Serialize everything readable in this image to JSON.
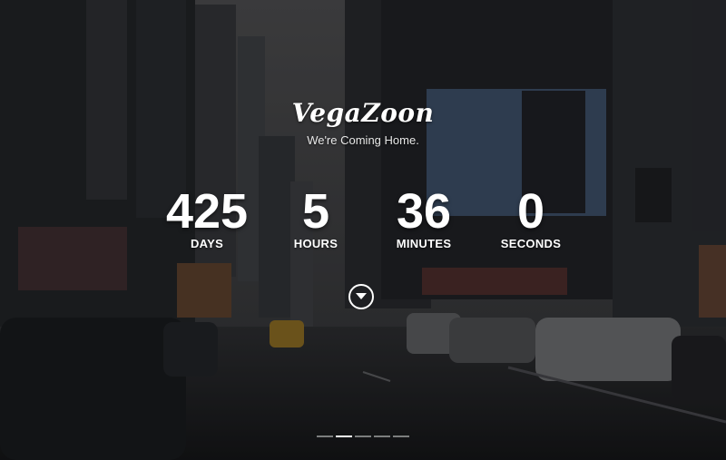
{
  "brand": {
    "logo": "VegaZoon",
    "tagline": "We're Coming Home."
  },
  "countdown": [
    {
      "value": "425",
      "label": "DAYS"
    },
    {
      "value": "5",
      "label": "HOURS"
    },
    {
      "value": "36",
      "label": "MINUTES"
    },
    {
      "value": "0",
      "label": "SECONDS"
    }
  ],
  "scroll_button": {
    "icon": "chevron-down-icon"
  },
  "slider": {
    "dots": 5,
    "active_index": 1
  },
  "colors": {
    "text": "#ffffff",
    "overlay": "#0a0a0c"
  }
}
